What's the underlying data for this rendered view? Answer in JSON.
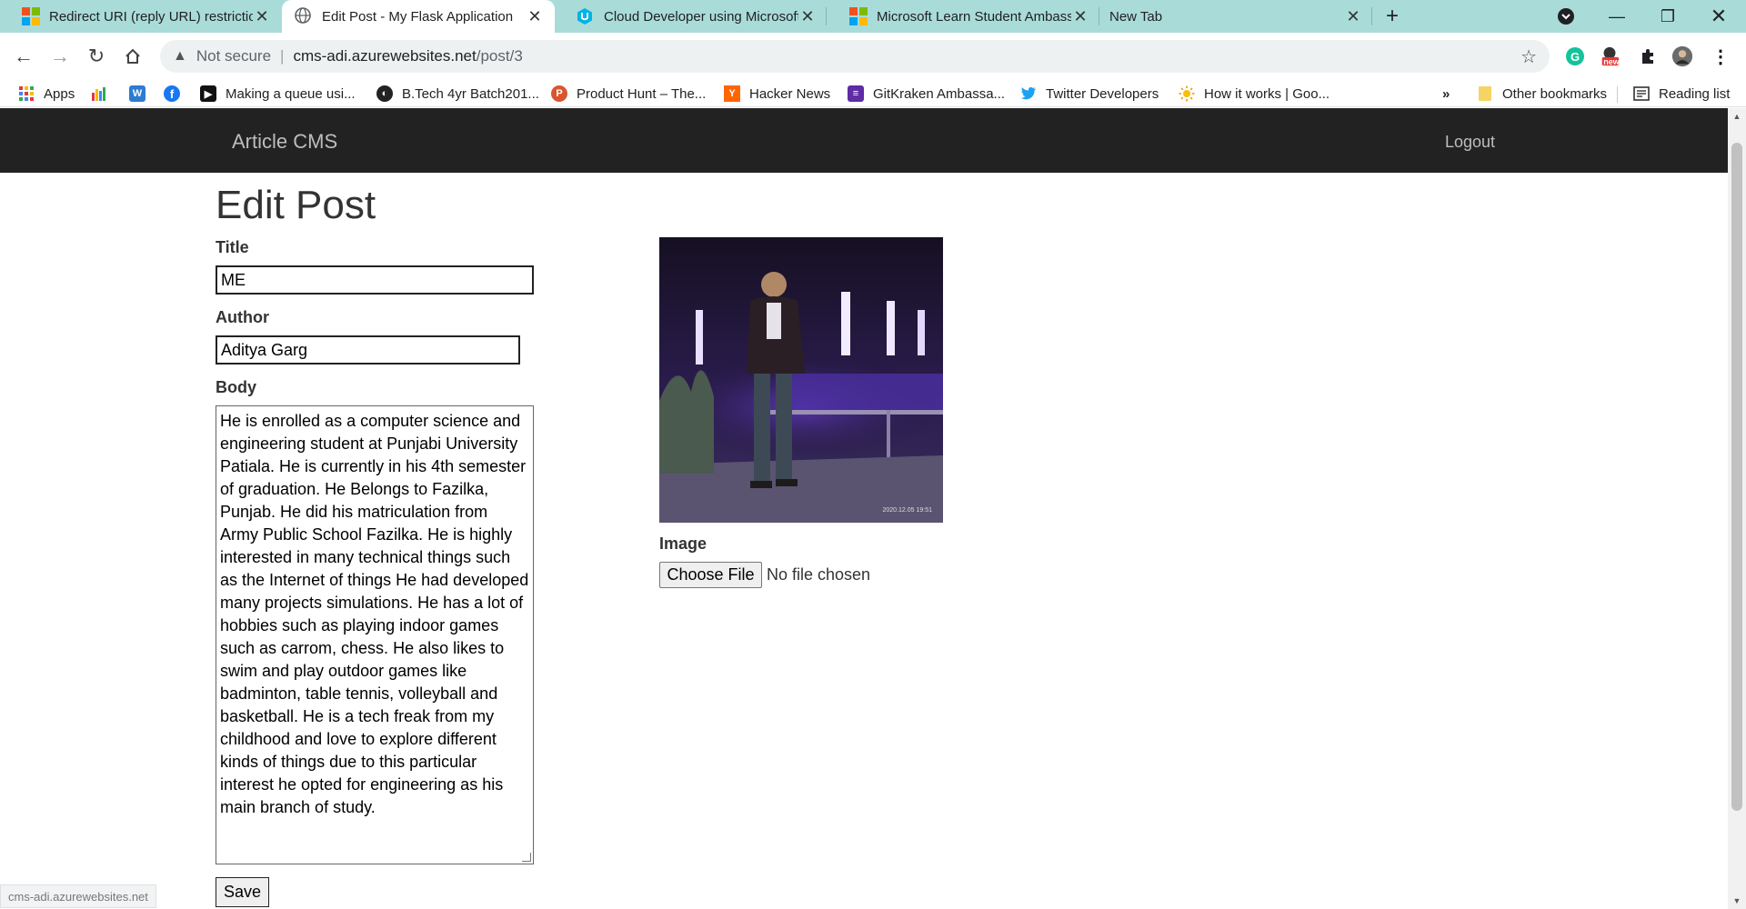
{
  "browser": {
    "tabs": [
      {
        "title": "Redirect URI (reply URL) restrictio",
        "icon": "microsoft-icon",
        "active": false
      },
      {
        "title": "Edit Post - My Flask Application",
        "icon": "globe-icon",
        "active": true
      },
      {
        "title": "Cloud Developer using Microsoft",
        "icon": "udacity-icon",
        "active": false
      },
      {
        "title": "Microsoft Learn Student Ambass",
        "icon": "microsoft-icon",
        "active": false
      },
      {
        "title": "New Tab",
        "icon": "",
        "active": false
      }
    ],
    "new_tab_symbol": "+",
    "address": {
      "security_label": "Not secure",
      "host": "cms-adi.azurewebsites.net",
      "path": "/post/3"
    },
    "extensions": {
      "new_badge": "new"
    },
    "bookmarks": [
      {
        "label": "Apps",
        "icon": "apps-grid-icon"
      },
      {
        "label": "",
        "icon": "chart-bookmark-icon"
      },
      {
        "label": "",
        "icon": "w-bookmark-icon"
      },
      {
        "label": "",
        "icon": "facebook-icon"
      },
      {
        "label": "Making a queue usi...",
        "icon": "cursor-bookmark-icon"
      },
      {
        "label": "B.Tech 4yr Batch201...",
        "icon": "dark-globe-icon"
      },
      {
        "label": "Product Hunt – The...",
        "icon": "product-hunt-icon"
      },
      {
        "label": "Hacker News",
        "icon": "hacker-news-icon"
      },
      {
        "label": "GitKraken Ambassa...",
        "icon": "gitkraken-icon"
      },
      {
        "label": "Twitter Developers",
        "icon": "twitter-icon"
      },
      {
        "label": "How it works | Goo...",
        "icon": "sun-icon"
      }
    ],
    "bookmarks_overflow": "»",
    "other_bookmarks": "Other bookmarks",
    "reading_list": "Reading list",
    "status_link": "cms-adi.azurewebsites.net"
  },
  "app": {
    "brand": "Article CMS",
    "logout": "Logout"
  },
  "form": {
    "heading": "Edit Post",
    "title_label": "Title",
    "title_value": "ME",
    "author_label": "Author",
    "author_value": "Aditya Garg",
    "body_label": "Body",
    "body_value": "He is enrolled as a computer science and engineering student at Punjabi University Patiala. He is currently in his 4th semester of graduation. He Belongs to Fazilka, Punjab. He did his matriculation from Army Public School Fazilka. He is highly interested in many technical things such as the Internet of things He had developed many projects simulations. He has a lot of hobbies such as playing indoor games such as carrom, chess. He also likes to swim and play outdoor games like badminton, table tennis, volleyball and basketball. He is a tech freak from my childhood and love to explore different kinds of things due to this particular interest he opted for engineering as his main branch of study.",
    "image_label": "Image",
    "choose_file": "Choose File",
    "no_file": "No file chosen",
    "save": "Save",
    "photo_timestamp": "2020.12.05 19:51"
  },
  "colors": {
    "tabstrip": "#a9dcd9",
    "navbar": "#222222"
  }
}
